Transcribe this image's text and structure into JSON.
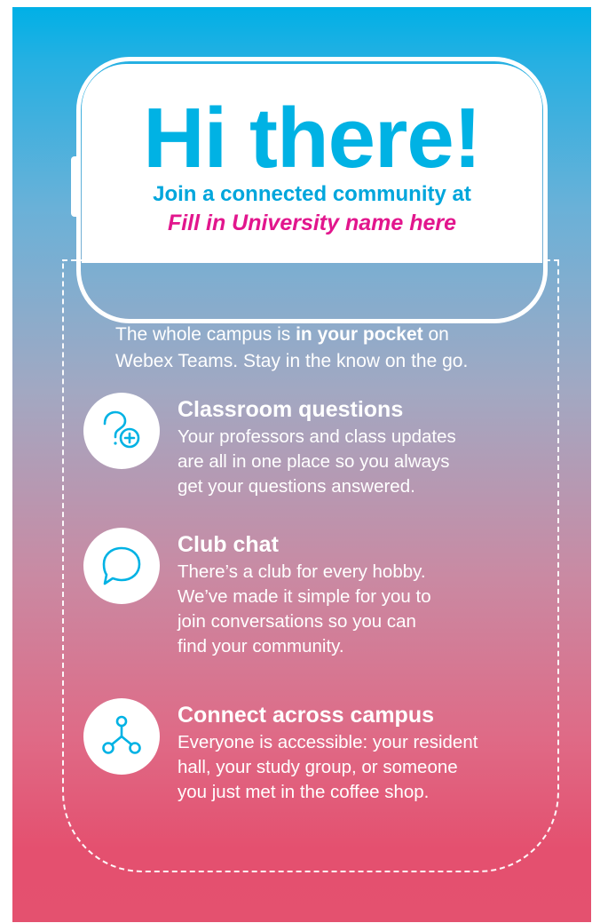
{
  "header": {
    "greeting": "Hi there!",
    "subtitle": "Join a connected community at",
    "university_placeholder": "Fill in University name here"
  },
  "intro": {
    "text_before": "The whole campus is ",
    "text_bold": "in your pocket",
    "text_after": " on",
    "line2": "Webex Teams. Stay in the know on the go."
  },
  "features": [
    {
      "icon": "question-plus-icon",
      "title": "Classroom questions",
      "lines": [
        "Your professors and class updates",
        "are all in one place so you always",
        "get your questions answered."
      ]
    },
    {
      "icon": "chat-bubble-icon",
      "title": "Club chat",
      "lines": [
        "There’s a club for every hobby.",
        "We’ve made it simple for you to",
        "join conversations so you can",
        "find your community."
      ]
    },
    {
      "icon": "network-icon",
      "title": "Connect across campus",
      "lines": [
        "Everyone is accessible: your resident",
        "hall, your study group, or someone",
        "you just met in the coffee shop."
      ]
    }
  ],
  "colors": {
    "accent_blue": "#00b2e4",
    "accent_pink": "#e2168d",
    "gradient_top": "#00b0e6",
    "gradient_bottom": "#e4516f"
  }
}
